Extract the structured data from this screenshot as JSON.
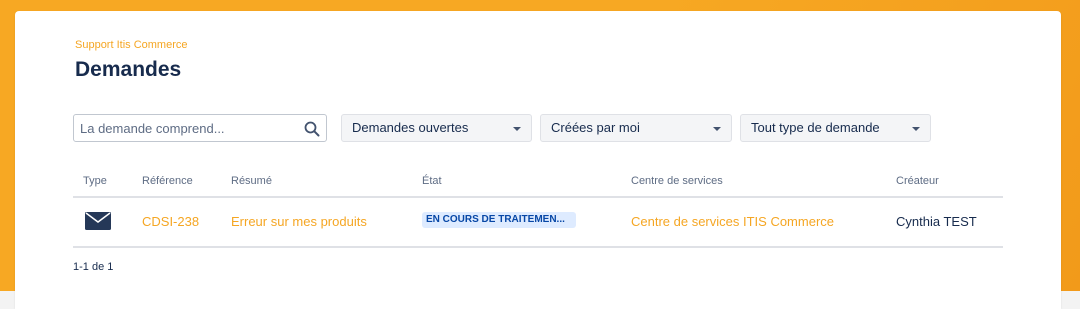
{
  "header": {
    "breadcrumb": "Support Itis Commerce",
    "title": "Demandes"
  },
  "filters": {
    "search_placeholder": "La demande comprend...",
    "status_select": "Demandes ouvertes",
    "creator_select": "Créées par moi",
    "type_select": "Tout type de demande"
  },
  "table": {
    "columns": [
      "Type",
      "Référence",
      "Résumé",
      "État",
      "Centre de services",
      "Créateur"
    ],
    "rows": [
      {
        "type_icon": "mail-icon",
        "reference": "CDSI-238",
        "summary": "Erreur sur mes produits",
        "status": "EN COURS DE TRAITEMEN...",
        "service_desk": "Centre de services ITIS Commerce",
        "creator": "Cynthia TEST"
      }
    ]
  },
  "pagination": "1-1 de 1",
  "colors": {
    "accent": "#f5a623",
    "title": "#172b4d",
    "status_bg": "#deebff",
    "status_text": "#0747a6"
  }
}
